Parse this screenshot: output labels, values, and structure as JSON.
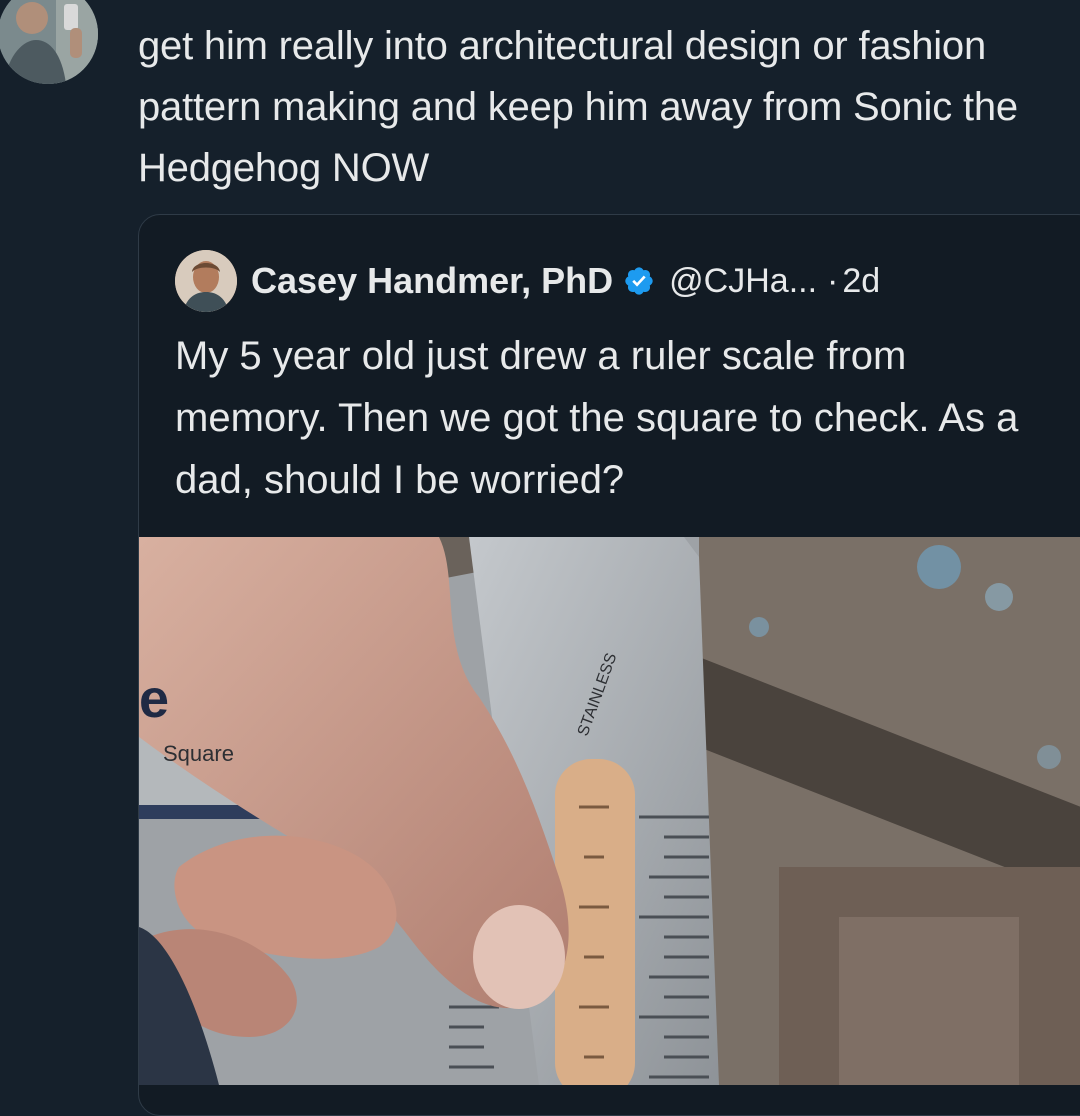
{
  "main_tweet": {
    "text": "get him really into architectural design or fashion pattern making and keep him away from Sonic the Hedgehog NOW"
  },
  "quoted_tweet": {
    "author_name": "Casey Handmer, PhD",
    "handle": "@CJHa...",
    "separator": "·",
    "time": "2d",
    "text": "My 5 year old just drew a ruler scale from memory. Then we got the square to check. As a dad, should I be worried?",
    "media": {
      "label_square": "Square",
      "label_stainless": "STAINLESS",
      "label_brand": "e"
    }
  },
  "colors": {
    "background": "#15202b",
    "text": "#e7e9ea",
    "verified_badge": "#1d9bf0"
  },
  "icons": {
    "verified": "verified-badge-icon"
  }
}
